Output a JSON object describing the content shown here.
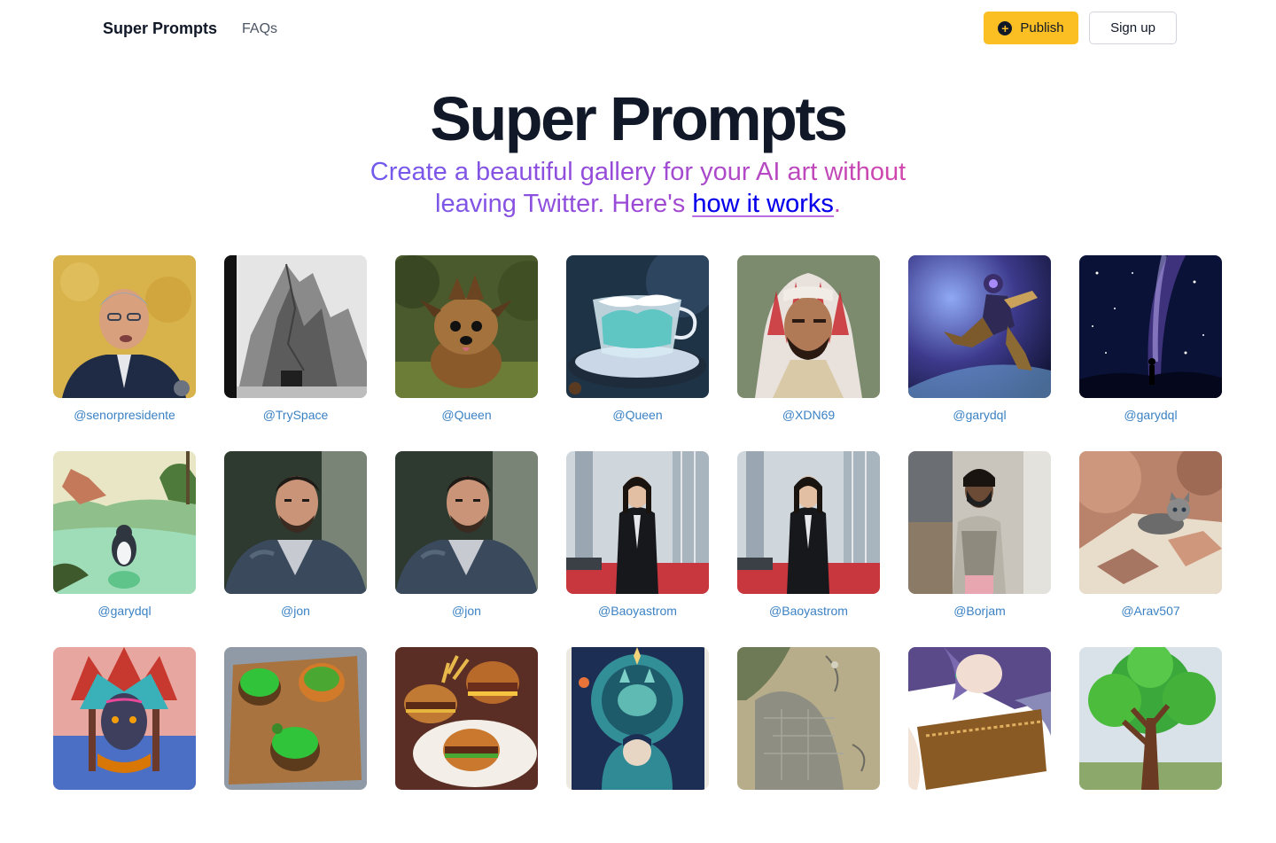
{
  "nav": {
    "brand": "Super Prompts",
    "faq": "FAQs",
    "publish": "Publish",
    "signup": "Sign up"
  },
  "hero": {
    "title": "Super Prompts",
    "subtitle_main": "Create a beautiful gallery for your AI art without leaving Twitter. Here's ",
    "subtitle_link": "how it works",
    "subtitle_end": "."
  },
  "gallery": [
    {
      "handle": "@senorpresidente",
      "image": "portrait-man-with-glasses"
    },
    {
      "handle": "@TrySpace",
      "image": "rocky-mountain-bw"
    },
    {
      "handle": "@Queen",
      "image": "yorkie-dog"
    },
    {
      "handle": "@Queen",
      "image": "cloud-teacup"
    },
    {
      "handle": "@XDN69",
      "image": "man-in-red-keffiyeh"
    },
    {
      "handle": "@garydql",
      "image": "space-robot"
    },
    {
      "handle": "@garydql",
      "image": "milky-way-silhouette"
    },
    {
      "handle": "@garydql",
      "image": "penguin-in-pond"
    },
    {
      "handle": "@jon",
      "image": "man-in-jacket"
    },
    {
      "handle": "@jon",
      "image": "man-in-jacket"
    },
    {
      "handle": "@Baoyastrom",
      "image": "woman-in-office"
    },
    {
      "handle": "@Baoyastrom",
      "image": "woman-in-office"
    },
    {
      "handle": "@Borjam",
      "image": "woman-with-mask"
    },
    {
      "handle": "@Arav507",
      "image": "kitten-on-blanket"
    },
    {
      "handle": "",
      "image": "tribal-painted-face"
    },
    {
      "handle": "",
      "image": "green-burgers"
    },
    {
      "handle": "",
      "image": "burgers-and-fries"
    },
    {
      "handle": "",
      "image": "cosmic-cat-illustration"
    },
    {
      "handle": "",
      "image": "aerial-city-map"
    },
    {
      "handle": "",
      "image": "anime-girl"
    },
    {
      "handle": "",
      "image": "green-tree-painting"
    }
  ]
}
